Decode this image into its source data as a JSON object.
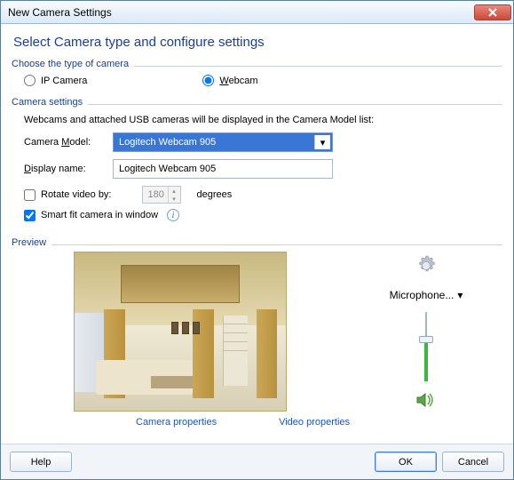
{
  "window": {
    "title": "New Camera Settings"
  },
  "heading": "Select Camera type and configure settings",
  "group_type": {
    "label": "Choose the type of camera",
    "ip_label": "IP Camera",
    "webcam_label": "Webcam"
  },
  "group_settings": {
    "label": "Camera settings",
    "hint": "Webcams and attached USB cameras will be displayed in the Camera Model list:",
    "model_label_pre": "Camera ",
    "model_label_u": "M",
    "model_label_post": "odel:",
    "model_value": "Logitech Webcam 905",
    "display_label_pre": "",
    "display_label_u": "D",
    "display_label_post": "isplay name:",
    "display_value": "Logitech Webcam 905",
    "rotate_label": "Rotate video by:",
    "rotate_value": "180",
    "rotate_unit": "degrees",
    "smartfit_label": "Smart fit camera in window"
  },
  "preview": {
    "label": "Preview",
    "mic_label": "Microphone...",
    "camera_props": "Camera properties",
    "video_props": "Video properties"
  },
  "footer": {
    "help": "Help",
    "ok": "OK",
    "cancel": "Cancel"
  }
}
